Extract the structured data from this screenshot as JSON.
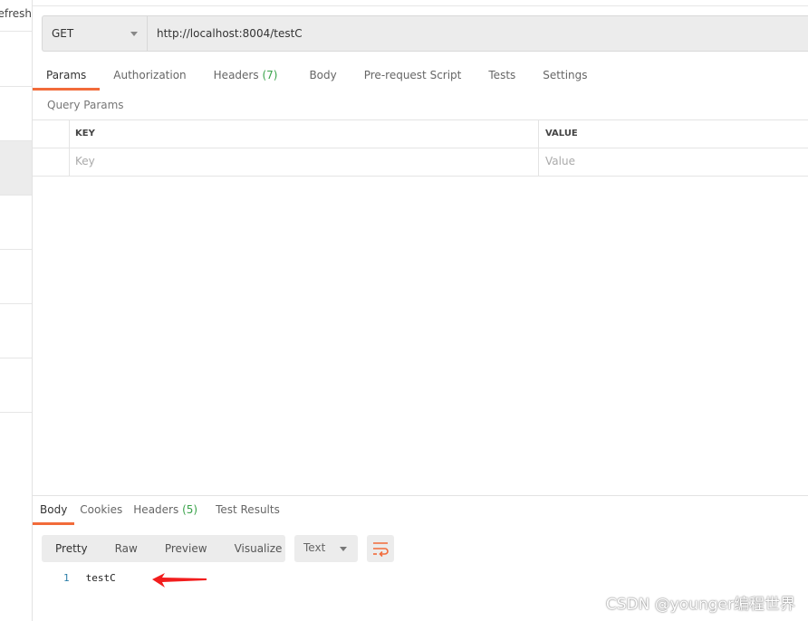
{
  "sidebar": {
    "top_label": "Refresh"
  },
  "request": {
    "method": "GET",
    "url": "http://localhost:8004/testC"
  },
  "tabs": [
    {
      "label": "Params"
    },
    {
      "label": "Authorization"
    },
    {
      "label": "Headers",
      "count": "(7)"
    },
    {
      "label": "Body"
    },
    {
      "label": "Pre-request Script"
    },
    {
      "label": "Tests"
    },
    {
      "label": "Settings"
    }
  ],
  "query_params": {
    "title": "Query Params",
    "key_header": "KEY",
    "value_header": "VALUE",
    "key_placeholder": "Key",
    "value_placeholder": "Value"
  },
  "response": {
    "tabs": [
      {
        "label": "Body"
      },
      {
        "label": "Cookies"
      },
      {
        "label": "Headers",
        "count": "(5)"
      },
      {
        "label": "Test Results"
      }
    ],
    "views": [
      "Pretty",
      "Raw",
      "Preview",
      "Visualize"
    ],
    "format": "Text",
    "lines": [
      {
        "num": "1",
        "text": "testC"
      }
    ]
  },
  "watermark": "CSDN @younger编程世界",
  "colors": {
    "accent": "#f26b3a",
    "count": "#3aa34b",
    "arrow": "#f21d1d"
  }
}
